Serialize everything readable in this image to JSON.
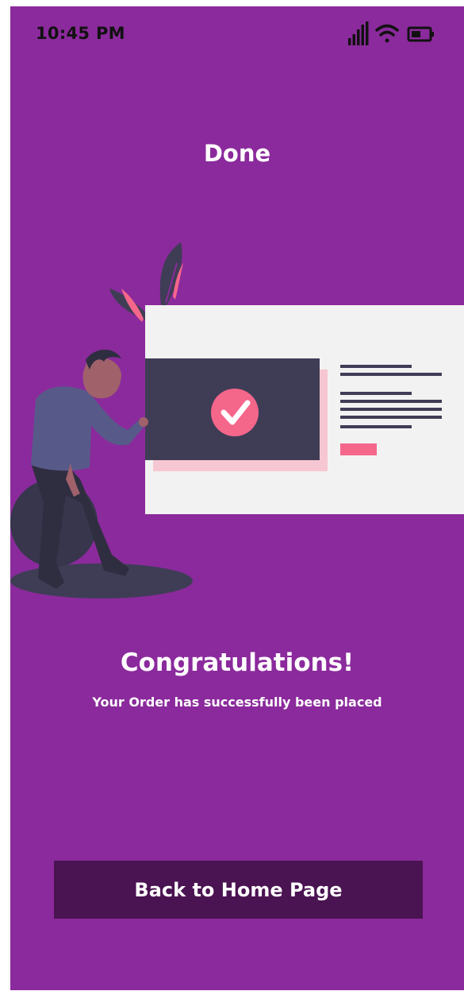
{
  "status_bar": {
    "time": "10:45 PM",
    "icons": [
      "signal-icon",
      "wifi-icon",
      "battery-icon"
    ]
  },
  "header": {
    "title": "Done"
  },
  "illustration": {
    "name": "order-success-illustration",
    "icon": "checkmark-icon"
  },
  "message": {
    "heading": "Congratulations!",
    "body": "Your Order has successfully been placed"
  },
  "actions": {
    "home_button_label": "Back to Home Page"
  },
  "colors": {
    "background": "#8b2a9c",
    "button": "#4a1351",
    "accent_pink": "#f5668b",
    "dark_figure": "#3f3d56",
    "card": "#f2f2f2"
  }
}
